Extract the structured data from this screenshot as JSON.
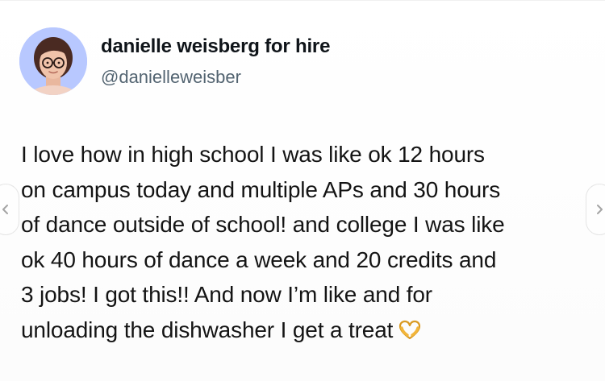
{
  "author": {
    "display_name": "danielle weisberg for hire",
    "handle": "@danielleweisber",
    "avatar_icon": "profile-photo",
    "avatar_bg": "#b8c8ff"
  },
  "tweet": {
    "lines": [
      "I love how in high school I was like ok 12 hours",
      "on campus today and multiple APs and 30 hours",
      "of dance outside of school! and college I was like",
      "ok 40 hours of dance a week and 20 credits and",
      "3 jobs! I got this!! And now I’m like and for",
      "unloading the dishwasher I get a treat"
    ],
    "end_emoji_icon": "heart-hands-icon",
    "end_emoji_color": "#f2b53a"
  },
  "carousel": {
    "prev_icon": "chevron-left-icon",
    "next_icon": "chevron-right-icon"
  }
}
